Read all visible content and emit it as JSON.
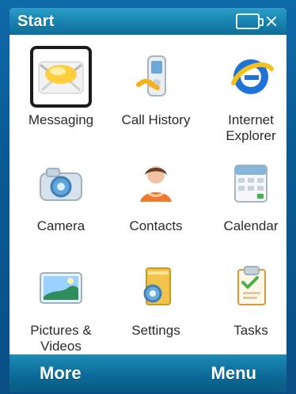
{
  "window": {
    "title": "Start"
  },
  "grid": {
    "items": [
      {
        "label": "Messaging",
        "icon": "envelope-icon",
        "selected": true
      },
      {
        "label": "Call History",
        "icon": "phone-icon",
        "selected": false
      },
      {
        "label": "Internet\nExplorer",
        "icon": "internet-explorer-icon",
        "selected": false
      },
      {
        "label": "Camera",
        "icon": "camera-icon",
        "selected": false
      },
      {
        "label": "Contacts",
        "icon": "person-icon",
        "selected": false
      },
      {
        "label": "Calendar",
        "icon": "calendar-icon",
        "selected": false
      },
      {
        "label": "Pictures &\nVideos",
        "icon": "picture-icon",
        "selected": false
      },
      {
        "label": "Settings",
        "icon": "settings-icon",
        "selected": false
      },
      {
        "label": "Tasks",
        "icon": "tasks-icon",
        "selected": false
      }
    ]
  },
  "softkeys": {
    "left": "More",
    "right": "Menu"
  }
}
